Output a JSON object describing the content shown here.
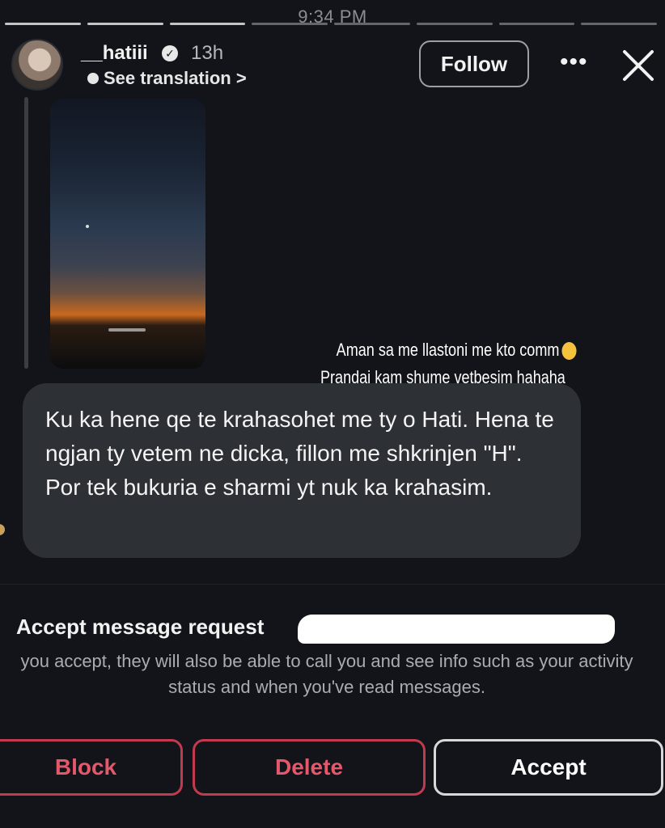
{
  "status_bar": {
    "time": "9:34 PM"
  },
  "header": {
    "username": "__hatiii",
    "time_ago": "13h",
    "see_translation": "See translation >",
    "follow_label": "Follow",
    "more_icon": "more-horizontal-icon",
    "close_icon": "close-icon"
  },
  "story": {
    "overlay_text_line1": "Aman sa me llastoni me kto comm",
    "overlay_text_line2": "Prandaj kam shume vetbesim hahaha",
    "emoji_icon": "rofl-emoji-icon"
  },
  "message": {
    "text": "Ku ka hene qe te krahasohet me ty o Hati. Hena te ngjan ty vetem ne dicka, fillon me shkrinjen \"H\". Por tek bukuria e sharmi yt nuk ka krahasim."
  },
  "request": {
    "title": "Accept message request",
    "description": "you accept, they will also be able to call you and see info such as your activity status and when you've read messages."
  },
  "actions": {
    "block_label": "Block",
    "delete_label": "Delete",
    "accept_label": "Accept"
  },
  "colors": {
    "background": "#121419",
    "bubble": "#2d3035",
    "danger": "#c23a4d",
    "danger_text": "#e4586b"
  }
}
